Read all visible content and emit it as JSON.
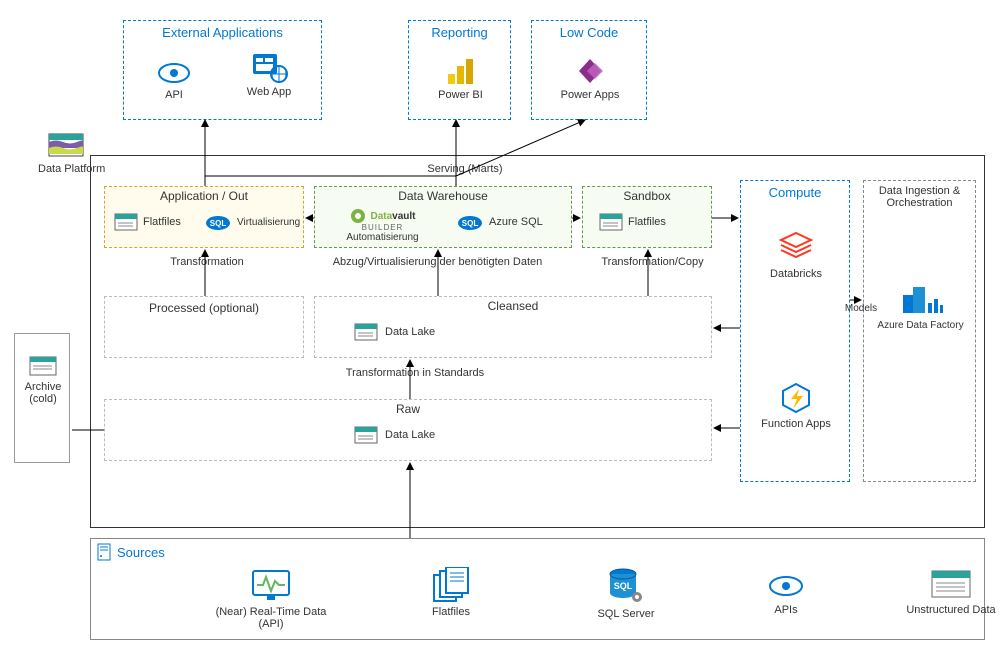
{
  "top": {
    "external": {
      "title": "External Applications",
      "api": "API",
      "webapp": "Web App"
    },
    "reporting": {
      "title": "Reporting",
      "powerbi": "Power BI"
    },
    "lowcode": {
      "title": "Low Code",
      "powerapps": "Power Apps"
    }
  },
  "platform": {
    "title": "Data Platform",
    "appout": {
      "title": "Application / Out",
      "flatfiles": "Flatfiles",
      "virt": "Virtualisierung"
    },
    "dw": {
      "title": "Data Warehouse",
      "auto": "Automatisierung",
      "azuresql": "Azure SQL"
    },
    "sandbox": {
      "title": "Sandbox",
      "flatfiles": "Flatfiles"
    },
    "compute": {
      "title": "Compute",
      "databricks": "Databricks",
      "functions": "Function Apps"
    },
    "ingest": {
      "title": "Data Ingestion & Orchestration",
      "adf": "Azure Data Factory"
    },
    "processed": {
      "title": "Processed (optional)"
    },
    "cleansed": {
      "title": "Cleansed",
      "datalake": "Data Lake"
    },
    "raw": {
      "title": "Raw",
      "datalake": "Data Lake"
    },
    "arrows": {
      "serving": "Serving (Marts)",
      "transformation": "Transformation",
      "abzug": "Abzug/Virtualisierung der benötigten Daten",
      "transformcopy": "Transformation/Copy",
      "transformstd": "Transformation in Standards",
      "models": "Models"
    }
  },
  "archive": {
    "title": "Archive (cold)"
  },
  "sources": {
    "title": "Sources",
    "realtime": "(Near) Real-Time Data (API)",
    "flatfiles": "Flatfiles",
    "sqlserver": "SQL Server",
    "apis": "APIs",
    "unstructured": "Unstructured Data"
  }
}
